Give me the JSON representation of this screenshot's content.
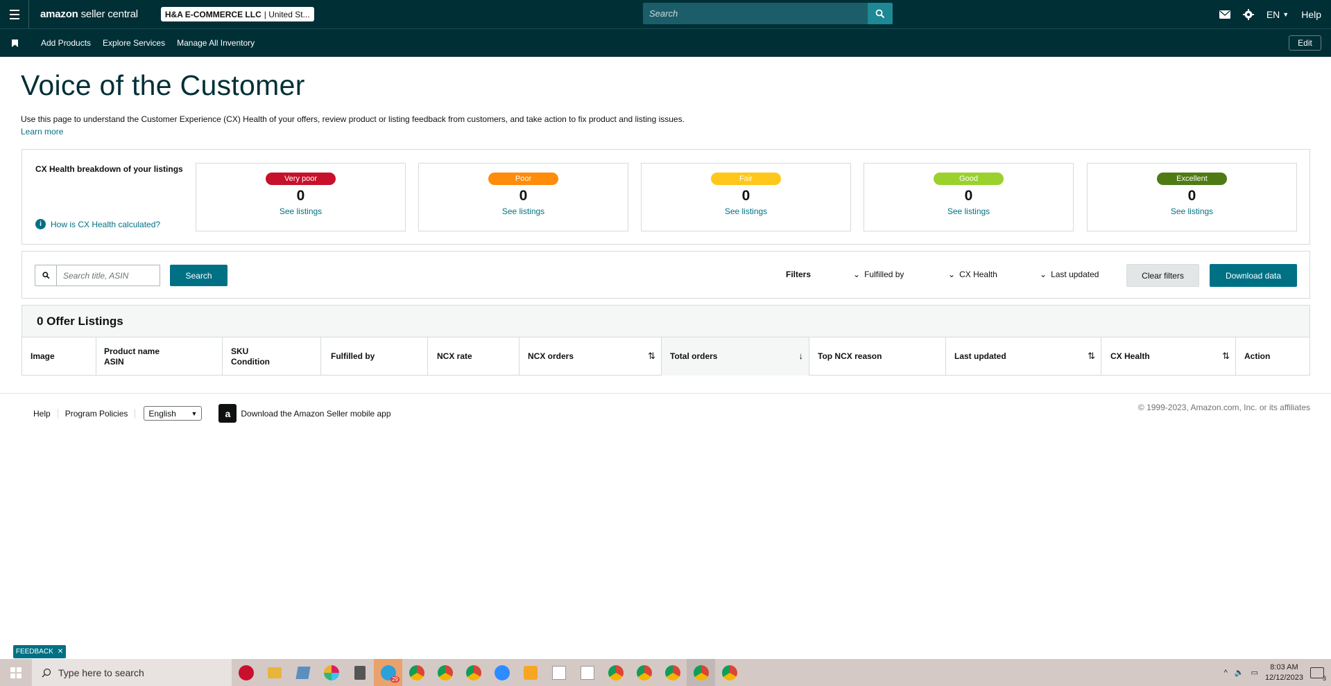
{
  "header": {
    "logo_text": "amazon",
    "logo_suffix": "seller central",
    "account_name": "H&A E-COMMERCE LLC",
    "account_region": "United St...",
    "search_placeholder": "Search",
    "language": "EN",
    "help": "Help"
  },
  "subnav": {
    "items": [
      "Add Products",
      "Explore Services",
      "Manage All Inventory"
    ],
    "edit": "Edit"
  },
  "page": {
    "title": "Voice of the Customer",
    "intro": "Use this page to understand the Customer Experience (CX) Health of your offers, review product or listing feedback from customers, and take action to fix product and listing issues.",
    "learn_more": "Learn more"
  },
  "cx_health": {
    "title": "CX Health breakdown of your listings",
    "help_link": "How is CX Health calculated?",
    "cards": [
      {
        "label": "Very poor",
        "count": "0",
        "link": "See listings",
        "color": "#c7102c"
      },
      {
        "label": "Poor",
        "count": "0",
        "link": "See listings",
        "color": "#ff8c0a"
      },
      {
        "label": "Fair",
        "count": "0",
        "link": "See listings",
        "color": "#ffc71a"
      },
      {
        "label": "Good",
        "count": "0",
        "link": "See listings",
        "color": "#9bd12d"
      },
      {
        "label": "Excellent",
        "count": "0",
        "link": "See listings",
        "color": "#4f7a14"
      }
    ]
  },
  "search_panel": {
    "placeholder": "Search title, ASIN",
    "search_button": "Search",
    "filters_label": "Filters",
    "filters": [
      "Fulfilled by",
      "CX Health",
      "Last updated"
    ],
    "clear_filters": "Clear filters",
    "download": "Download data"
  },
  "listings": {
    "title": "0 Offer Listings",
    "columns": [
      {
        "l1": "Image",
        "l2": ""
      },
      {
        "l1": "Product name",
        "l2": "ASIN"
      },
      {
        "l1": "SKU",
        "l2": "Condition"
      },
      {
        "l1": "Fulfilled by",
        "l2": ""
      },
      {
        "l1": "NCX rate",
        "l2": ""
      },
      {
        "l1": "NCX orders",
        "l2": ""
      },
      {
        "l1": "Total orders",
        "l2": ""
      },
      {
        "l1": "Top NCX reason",
        "l2": ""
      },
      {
        "l1": "Last updated",
        "l2": ""
      },
      {
        "l1": "CX Health",
        "l2": ""
      },
      {
        "l1": "Action",
        "l2": ""
      }
    ]
  },
  "footer": {
    "help": "Help",
    "policies": "Program Policies",
    "language": "English",
    "app_link": "Download the Amazon Seller mobile app",
    "copyright": "© 1999-2023, Amazon.com, Inc. or its affiliates"
  },
  "feedback": "FEEDBACK",
  "taskbar": {
    "search_placeholder": "Type here to search",
    "time": "8:03 AM",
    "date": "12/12/2023",
    "notification_count": "3",
    "badge_count": "29"
  },
  "colors": {
    "header_bg": "#002f36",
    "accent": "#007185"
  }
}
